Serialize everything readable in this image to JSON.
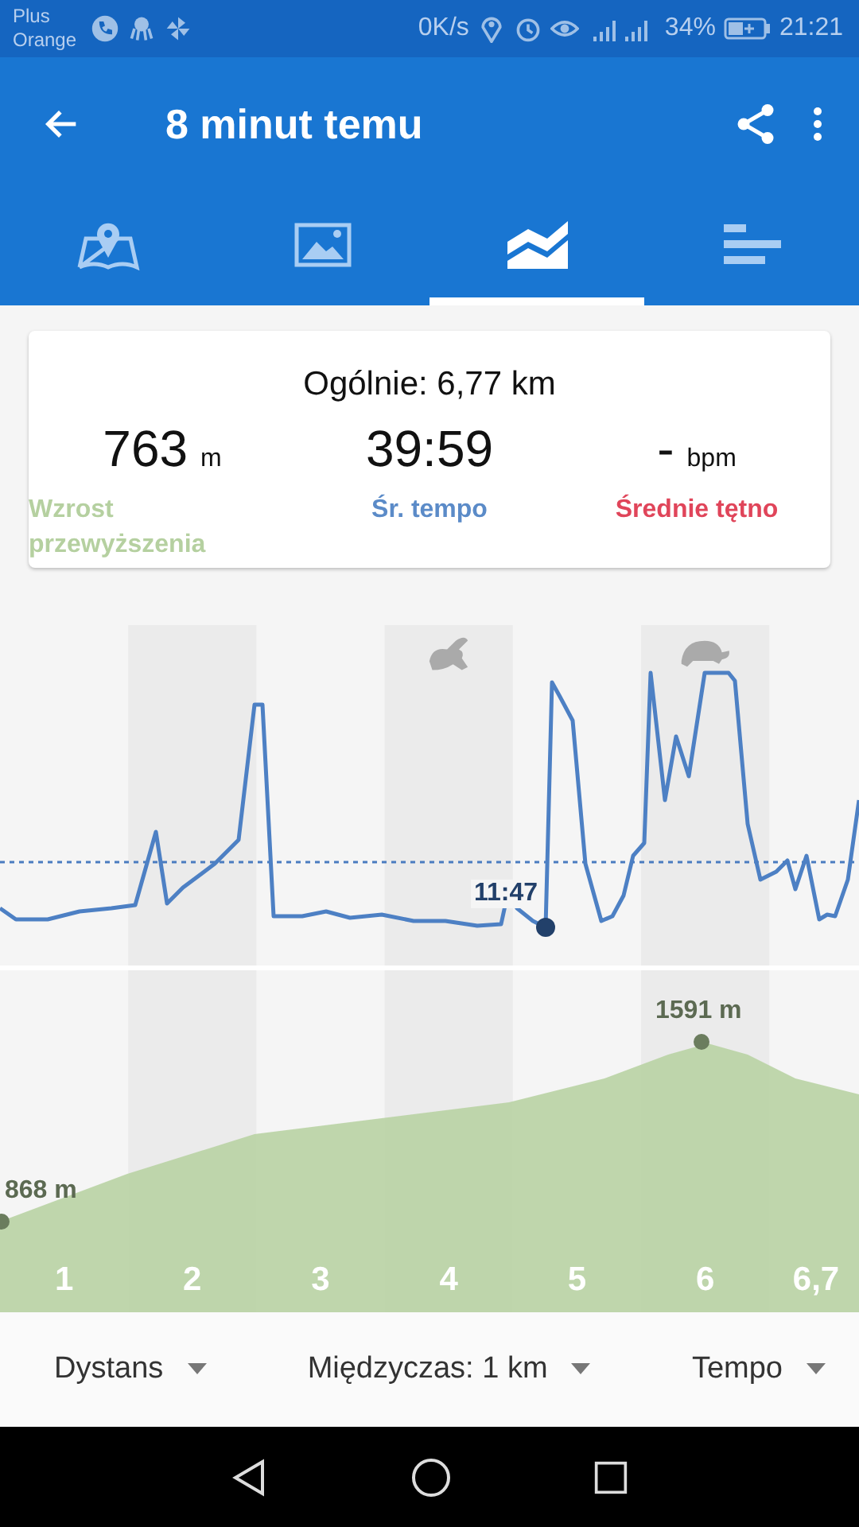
{
  "status_bar": {
    "carrier": [
      "Plus",
      "Orange"
    ],
    "speed": "0K/s",
    "battery": "34%",
    "time": "21:21"
  },
  "app_bar": {
    "title": "8 minut temu"
  },
  "tabs": [
    {
      "selected": false
    },
    {
      "selected": false
    },
    {
      "selected": true
    },
    {
      "selected": false
    }
  ],
  "summary": {
    "title": "Ogólnie: 6,77 km",
    "stats": [
      {
        "value": "763",
        "unit": "m",
        "label": "Wzrost przewyższenia",
        "color": "#b5d0a0"
      },
      {
        "value": "39:59",
        "label": "Śr. tempo",
        "color": "#5b8bc8"
      },
      {
        "value": "-",
        "unit": "bpm",
        "label": "Średnie tętno",
        "color": "#e0455a"
      }
    ]
  },
  "pace_chart": {
    "marker_label": "11:47"
  },
  "elevation_chart": {
    "start_label": "868 m",
    "peak_label": "1591 m",
    "distance_labels": [
      "1",
      "2",
      "3",
      "4",
      "5",
      "6",
      "6,7"
    ]
  },
  "bottom_bar": {
    "dropdowns": [
      "Dystans",
      "Międzyczas: 1 km",
      "Tempo"
    ]
  }
}
